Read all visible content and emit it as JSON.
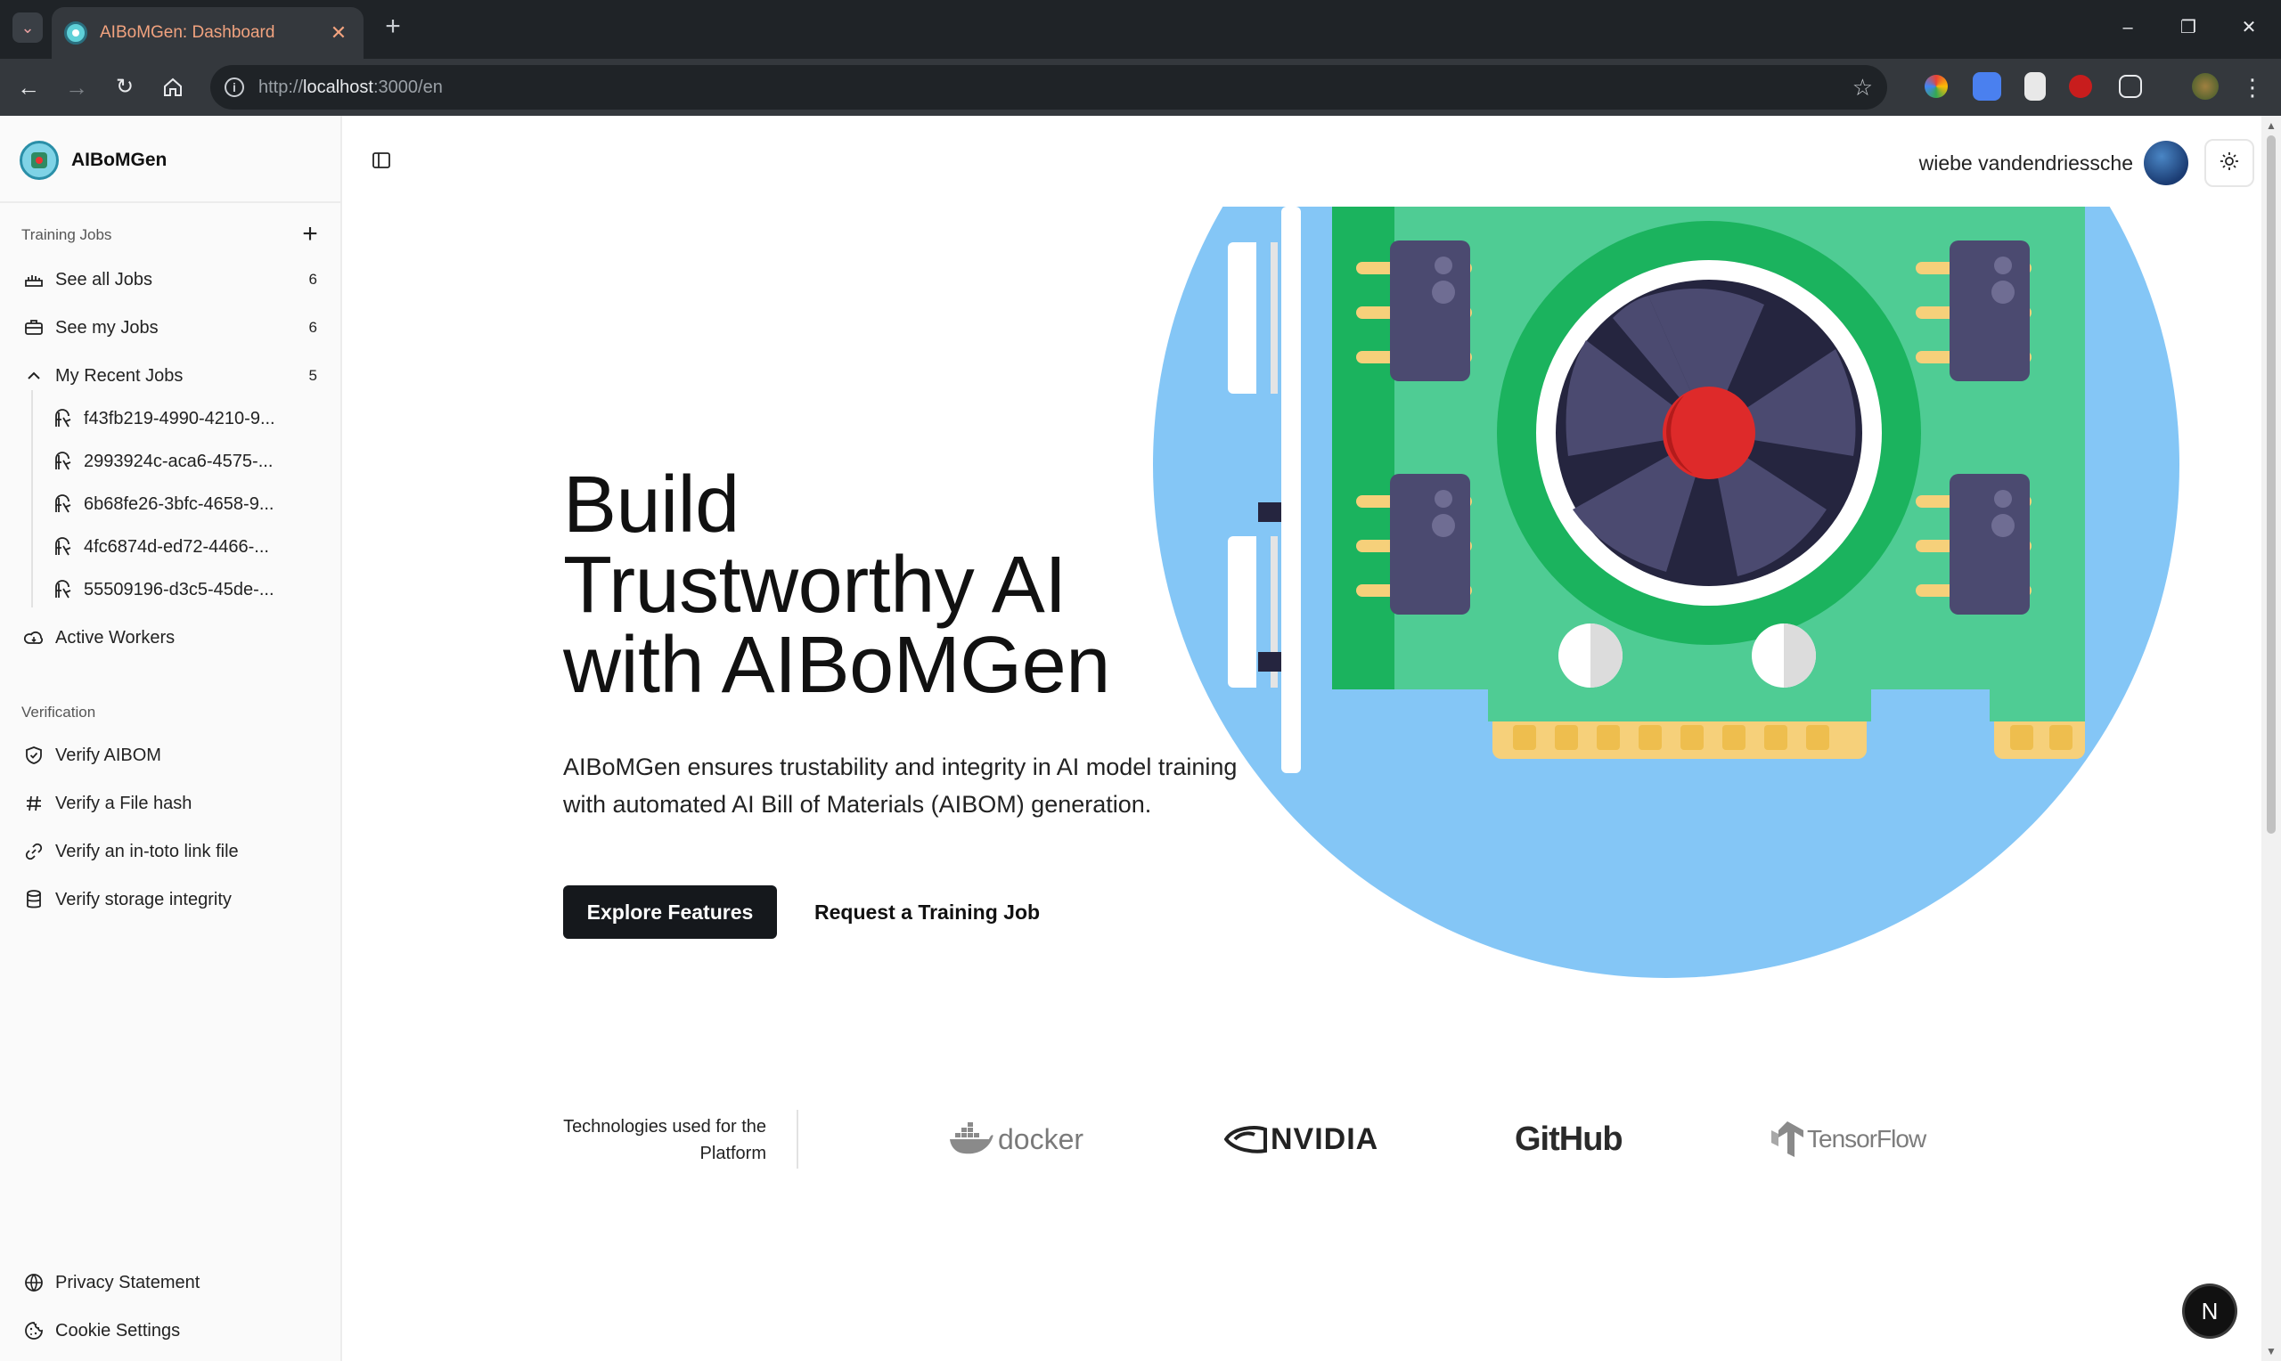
{
  "browser": {
    "tab_title": "AIBoMGen: Dashboard",
    "url_host": "localhost",
    "url_prefix": "http://",
    "url_suffix": ":3000/en"
  },
  "sidebar": {
    "brand": "AIBoMGen",
    "training_group": "Training Jobs",
    "items": [
      {
        "label": "See all Jobs",
        "count": "6"
      },
      {
        "label": "See my Jobs",
        "count": "6"
      },
      {
        "label": "My Recent Jobs",
        "count": "5"
      }
    ],
    "recent_jobs": [
      "f43fb219-4990-4210-9...",
      "2993924c-aca6-4575-...",
      "6b68fe26-3bfc-4658-9...",
      "4fc6874d-ed72-4466-...",
      "55509196-d3c5-45de-..."
    ],
    "active_workers": "Active Workers",
    "verification_group": "Verification",
    "verification_items": [
      "Verify AIBOM",
      "Verify a File hash",
      "Verify an in-toto link file",
      "Verify storage integrity"
    ],
    "footer_items": [
      "Privacy Statement",
      "Cookie Settings"
    ]
  },
  "header": {
    "user_name": "wiebe vandendriessche"
  },
  "hero": {
    "title_line1": "Build",
    "title_line2": "Trustworthy AI",
    "title_line3": "with AIBoMGen",
    "subtitle": "AIBoMGen ensures trustability and integrity in AI model training with automated AI Bill of Materials (AIBOM) generation.",
    "primary_button": "Explore Features",
    "secondary_button": "Request a Training Job"
  },
  "technologies": {
    "label": "Technologies used for the Platform",
    "logos": [
      "docker",
      "NVIDIA",
      "GitHub",
      "TensorFlow"
    ]
  },
  "dev_badge": "N",
  "icons": {
    "see_all": "jobs-icon",
    "see_my": "briefcase-icon",
    "recent": "chevron-up-icon",
    "job": "worker-icon",
    "active_workers": "cloud-icon",
    "verify_aibom": "shield-check-icon",
    "verify_hash": "hash-icon",
    "verify_link": "link-icon",
    "verify_storage": "database-icon",
    "privacy": "globe-icon",
    "cookie": "cookie-icon"
  },
  "colors": {
    "primary_button": "#15181c",
    "art_circle": "#84c6f6",
    "board_green": "#4fcc94",
    "chip": "#4b4a70",
    "fan_center": "#de2a2a"
  }
}
